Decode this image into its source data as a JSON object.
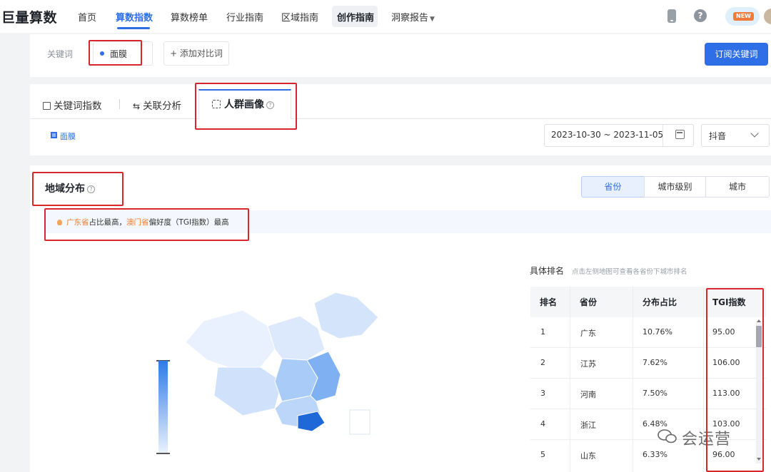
{
  "nav": {
    "logo": "巨量算数",
    "items": [
      "首页",
      "算数指数",
      "算数榜单",
      "行业指南",
      "区域指南",
      "创作指南",
      "洞察报告"
    ],
    "new_badge": "NEW"
  },
  "keyword": {
    "label": "关键词",
    "value": "面膜",
    "add_compare": "+ 添加对比词",
    "subscribe": "订阅关键词"
  },
  "tabs": {
    "items": [
      "关键词指数",
      "关联分析",
      "人群画像"
    ],
    "legend": "面膜",
    "date_range": "2023-10-30 ~ 2023-11-05",
    "platform": "抖音"
  },
  "region": {
    "title": "地域分布",
    "segments": [
      "省份",
      "城市级别",
      "城市"
    ],
    "tip": {
      "p1": "广东省",
      "t1": "占比最高，",
      "p2": "澳门省",
      "t2": "偏好度（TGI指数）最高"
    },
    "ranking_title": "具体排名",
    "ranking_hint": "点击左侧地图可查看各省份下城市排名",
    "headers": [
      "排名",
      "省份",
      "分布占比",
      "TGI指数"
    ],
    "rows": [
      {
        "rank": "1",
        "province": "广东",
        "share": "10.76%",
        "tgi": "95.00"
      },
      {
        "rank": "2",
        "province": "江苏",
        "share": "7.62%",
        "tgi": "106.00"
      },
      {
        "rank": "3",
        "province": "河南",
        "share": "7.50%",
        "tgi": "113.00"
      },
      {
        "rank": "4",
        "province": "浙江",
        "share": "6.48%",
        "tgi": "103.00"
      },
      {
        "rank": "5",
        "province": "山东",
        "share": "6.33%",
        "tgi": "96.00"
      }
    ]
  },
  "watermark": "会运营",
  "colors": {
    "accent": "#2e6fe7",
    "highlight": "#f07c2e",
    "annotation": "#d9262c"
  }
}
